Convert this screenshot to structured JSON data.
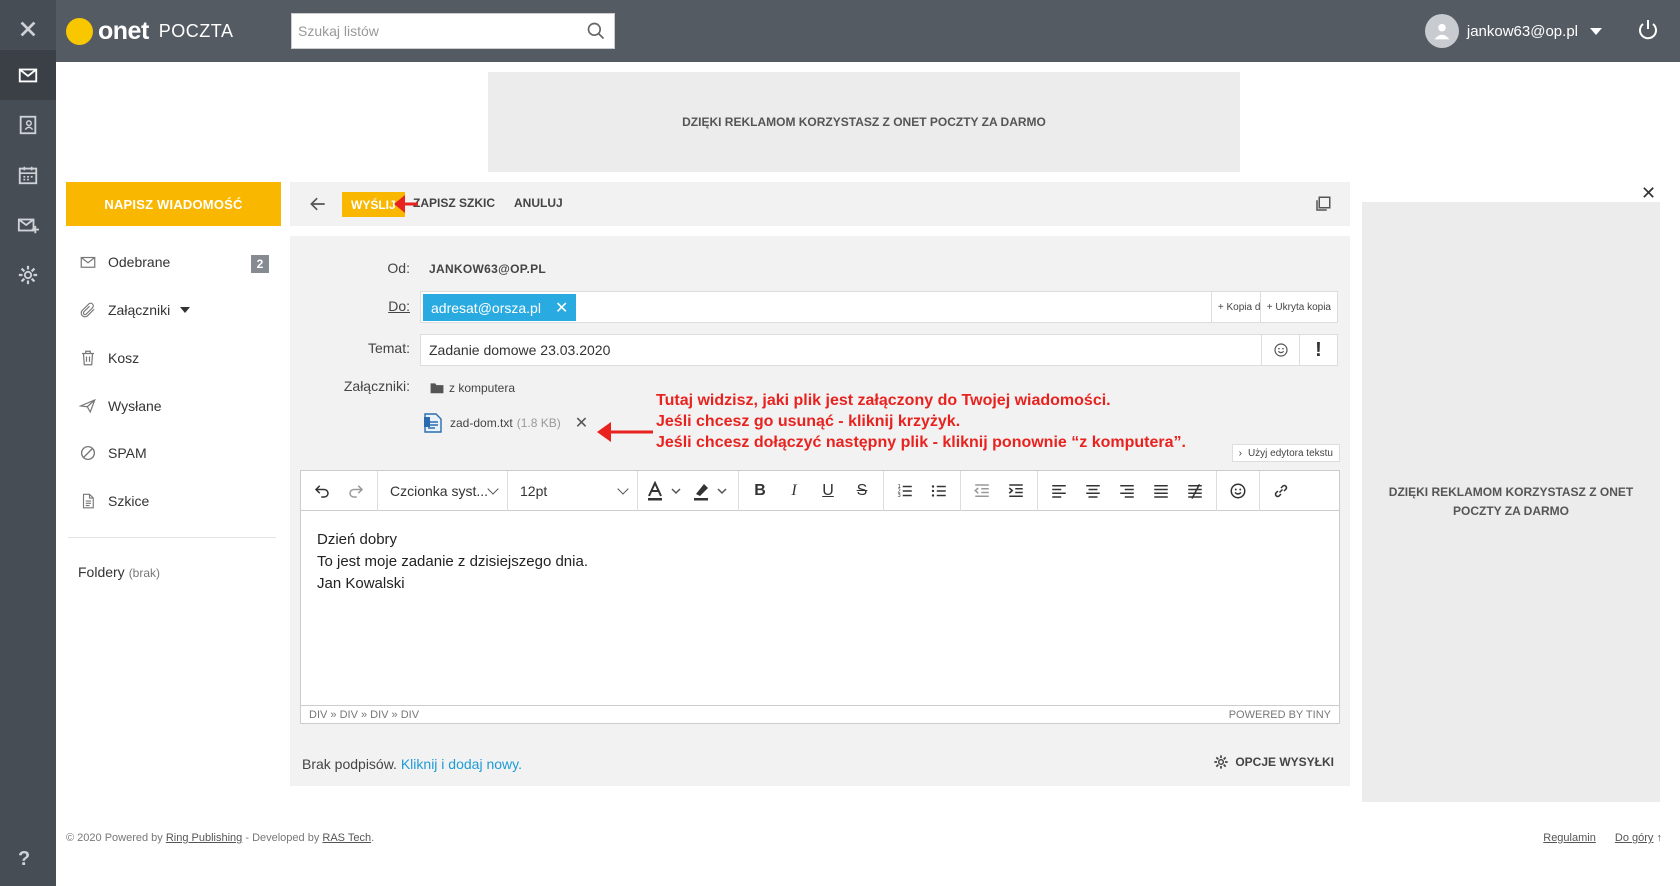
{
  "topbar": {
    "logo_brand": "onet",
    "logo_product": "POCZTA",
    "search_placeholder": "Szukaj listów",
    "user_email": "jankow63@op.pl"
  },
  "ads": {
    "top_text": "DZIĘKI REKLAMOM KORZYSTASZ Z ONET POCZTY ZA DARMO",
    "right_text": "DZIĘKI REKLAMOM KORZYSTASZ Z ONET POCZTY ZA DARMO"
  },
  "sidebar": {
    "compose_label": "NAPISZ WIADOMOŚĆ",
    "items": [
      {
        "label": "Odebrane",
        "icon": "envelope-icon",
        "badge": "2"
      },
      {
        "label": "Załączniki",
        "icon": "paperclip-icon"
      },
      {
        "label": "Kosz",
        "icon": "trash-icon"
      },
      {
        "label": "Wysłane",
        "icon": "send-icon"
      },
      {
        "label": "SPAM",
        "icon": "block-icon"
      },
      {
        "label": "Szkice",
        "icon": "draft-icon"
      }
    ],
    "folders_label": "Foldery",
    "folders_note": "(brak)"
  },
  "toolbar": {
    "send_label": "WYŚLIJ",
    "draft_label": "ZAPISZ SZKIC",
    "cancel_label": "ANULUJ"
  },
  "compose": {
    "from_label": "Od:",
    "from_value": "JANKOW63@OP.PL",
    "to_label": "Do:",
    "to_chip": "adresat@orsza.pl",
    "cc_label": "Kopia do",
    "bcc_label": "Ukryta kopia",
    "subject_label": "Temat:",
    "subject_value": "Zadanie domowe 23.03.2020",
    "attachments_label": "Załączniki:",
    "from_computer_label": "z komputera",
    "attachment_name": "zad-dom.txt",
    "attachment_size": "(1.8 KB)",
    "plain_editor_label": "Użyj edytora tekstu"
  },
  "annotation": {
    "line1": "Tutaj widzisz, jaki plik jest załączony do Twojej wiadomości.",
    "line2": "Jeśli chcesz go usunąć - kliknij krzyżyk.",
    "line3": "Jeśli chcesz dołączyć następny plik - kliknij ponownie “z komputera”.",
    "color": "#e8231f"
  },
  "editor": {
    "font_select": "Czcionka syst...",
    "size_select": "12pt",
    "body_lines": [
      "Dzień dobry",
      "To jest moje zadanie z dzisiejszego dnia.",
      "Jan Kowalski"
    ],
    "status_path": "DIV » DIV » DIV » DIV",
    "powered_by": "POWERED BY TINY"
  },
  "footer_actions": {
    "signature_text": "Brak podpisów.",
    "signature_link": "Kliknij i dodaj nowy.",
    "send_options": "OPCJE WYSYŁKI"
  },
  "footer": {
    "copyright_prefix": "© 2020 Powered by",
    "ring": "Ring Publishing",
    "dev_prefix": "- Developed by",
    "ras": "RAS Tech",
    "period": ".",
    "regulamin": "Regulamin",
    "top": "Do góry"
  },
  "colors": {
    "accent": "#f9b700",
    "chip": "#29abe2",
    "rail": "#474d55",
    "topbar": "#555b62"
  }
}
